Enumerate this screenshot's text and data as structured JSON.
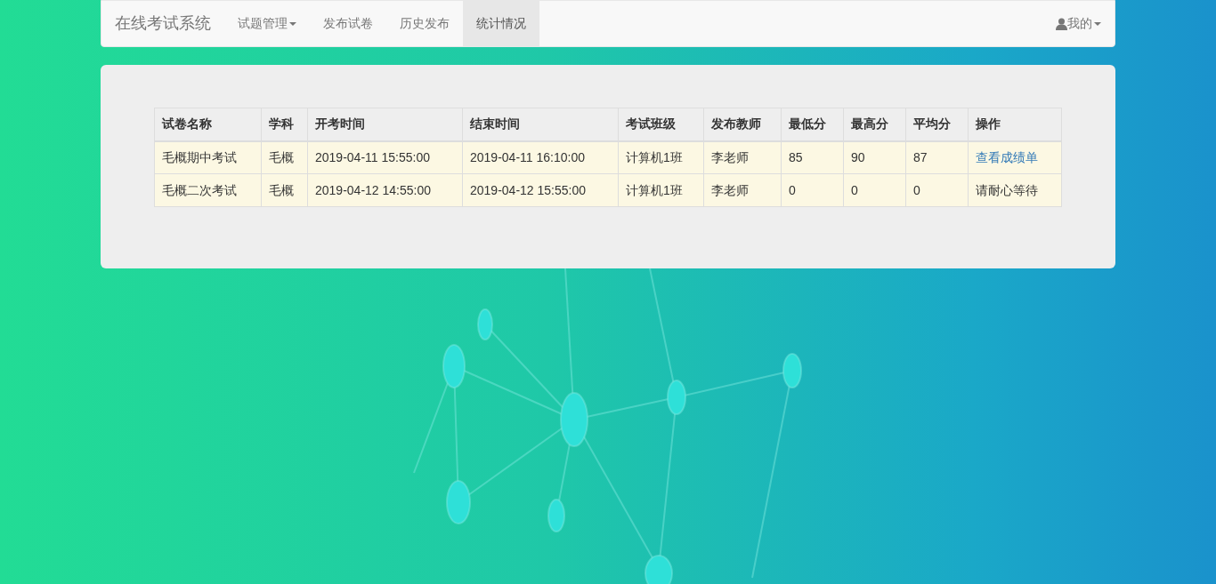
{
  "navbar": {
    "brand": "在线考试系统",
    "items": [
      {
        "label": "试题管理",
        "dropdown": true,
        "selected": false
      },
      {
        "label": "发布试卷",
        "dropdown": false,
        "selected": false
      },
      {
        "label": "历史发布",
        "dropdown": false,
        "selected": false
      },
      {
        "label": "统计情况",
        "dropdown": false,
        "selected": true
      }
    ],
    "user_menu": {
      "label": "我的",
      "dropdown": true
    }
  },
  "table": {
    "columns": [
      "试卷名称",
      "学科",
      "开考时间",
      "结束时间",
      "考试班级",
      "发布教师",
      "最低分",
      "最高分",
      "平均分",
      "操作"
    ],
    "rows": [
      {
        "cells": [
          "毛概期中考试",
          "毛概",
          "2019-04-11 15:55:00",
          "2019-04-11 16:10:00",
          "计算机1班",
          "李老师",
          "85",
          "90",
          "87"
        ],
        "action": {
          "kind": "link",
          "text": "查看成绩单"
        }
      },
      {
        "cells": [
          "毛概二次考试",
          "毛概",
          "2019-04-12 14:55:00",
          "2019-04-12 15:55:00",
          "计算机1班",
          "李老师",
          "0",
          "0",
          "0"
        ],
        "action": {
          "kind": "text",
          "text": "请耐心等待"
        }
      }
    ]
  }
}
